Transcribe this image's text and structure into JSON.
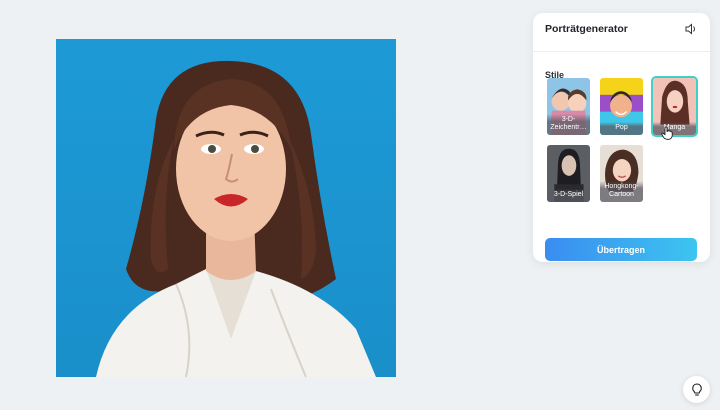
{
  "panel": {
    "title": "Porträtgenerator",
    "section_label": "Stile",
    "styles": [
      {
        "label": "3-D-Zeichentr…",
        "selected": false
      },
      {
        "label": "Pop",
        "selected": false
      },
      {
        "label": "Manga",
        "selected": true
      },
      {
        "label": "3-D-Spiel",
        "selected": false
      },
      {
        "label": "Hongkong-Cartoon",
        "selected": false
      }
    ],
    "apply_label": "Übertragen"
  },
  "icons": {
    "sound": "speaker-icon",
    "help": "lightbulb-icon",
    "cursor": "hand-pointer-icon"
  },
  "colors": {
    "accent": "#3fd0c7",
    "button_start": "#3a8df0",
    "button_end": "#3cc5f0",
    "canvas_bg": "#1d9ad6"
  }
}
